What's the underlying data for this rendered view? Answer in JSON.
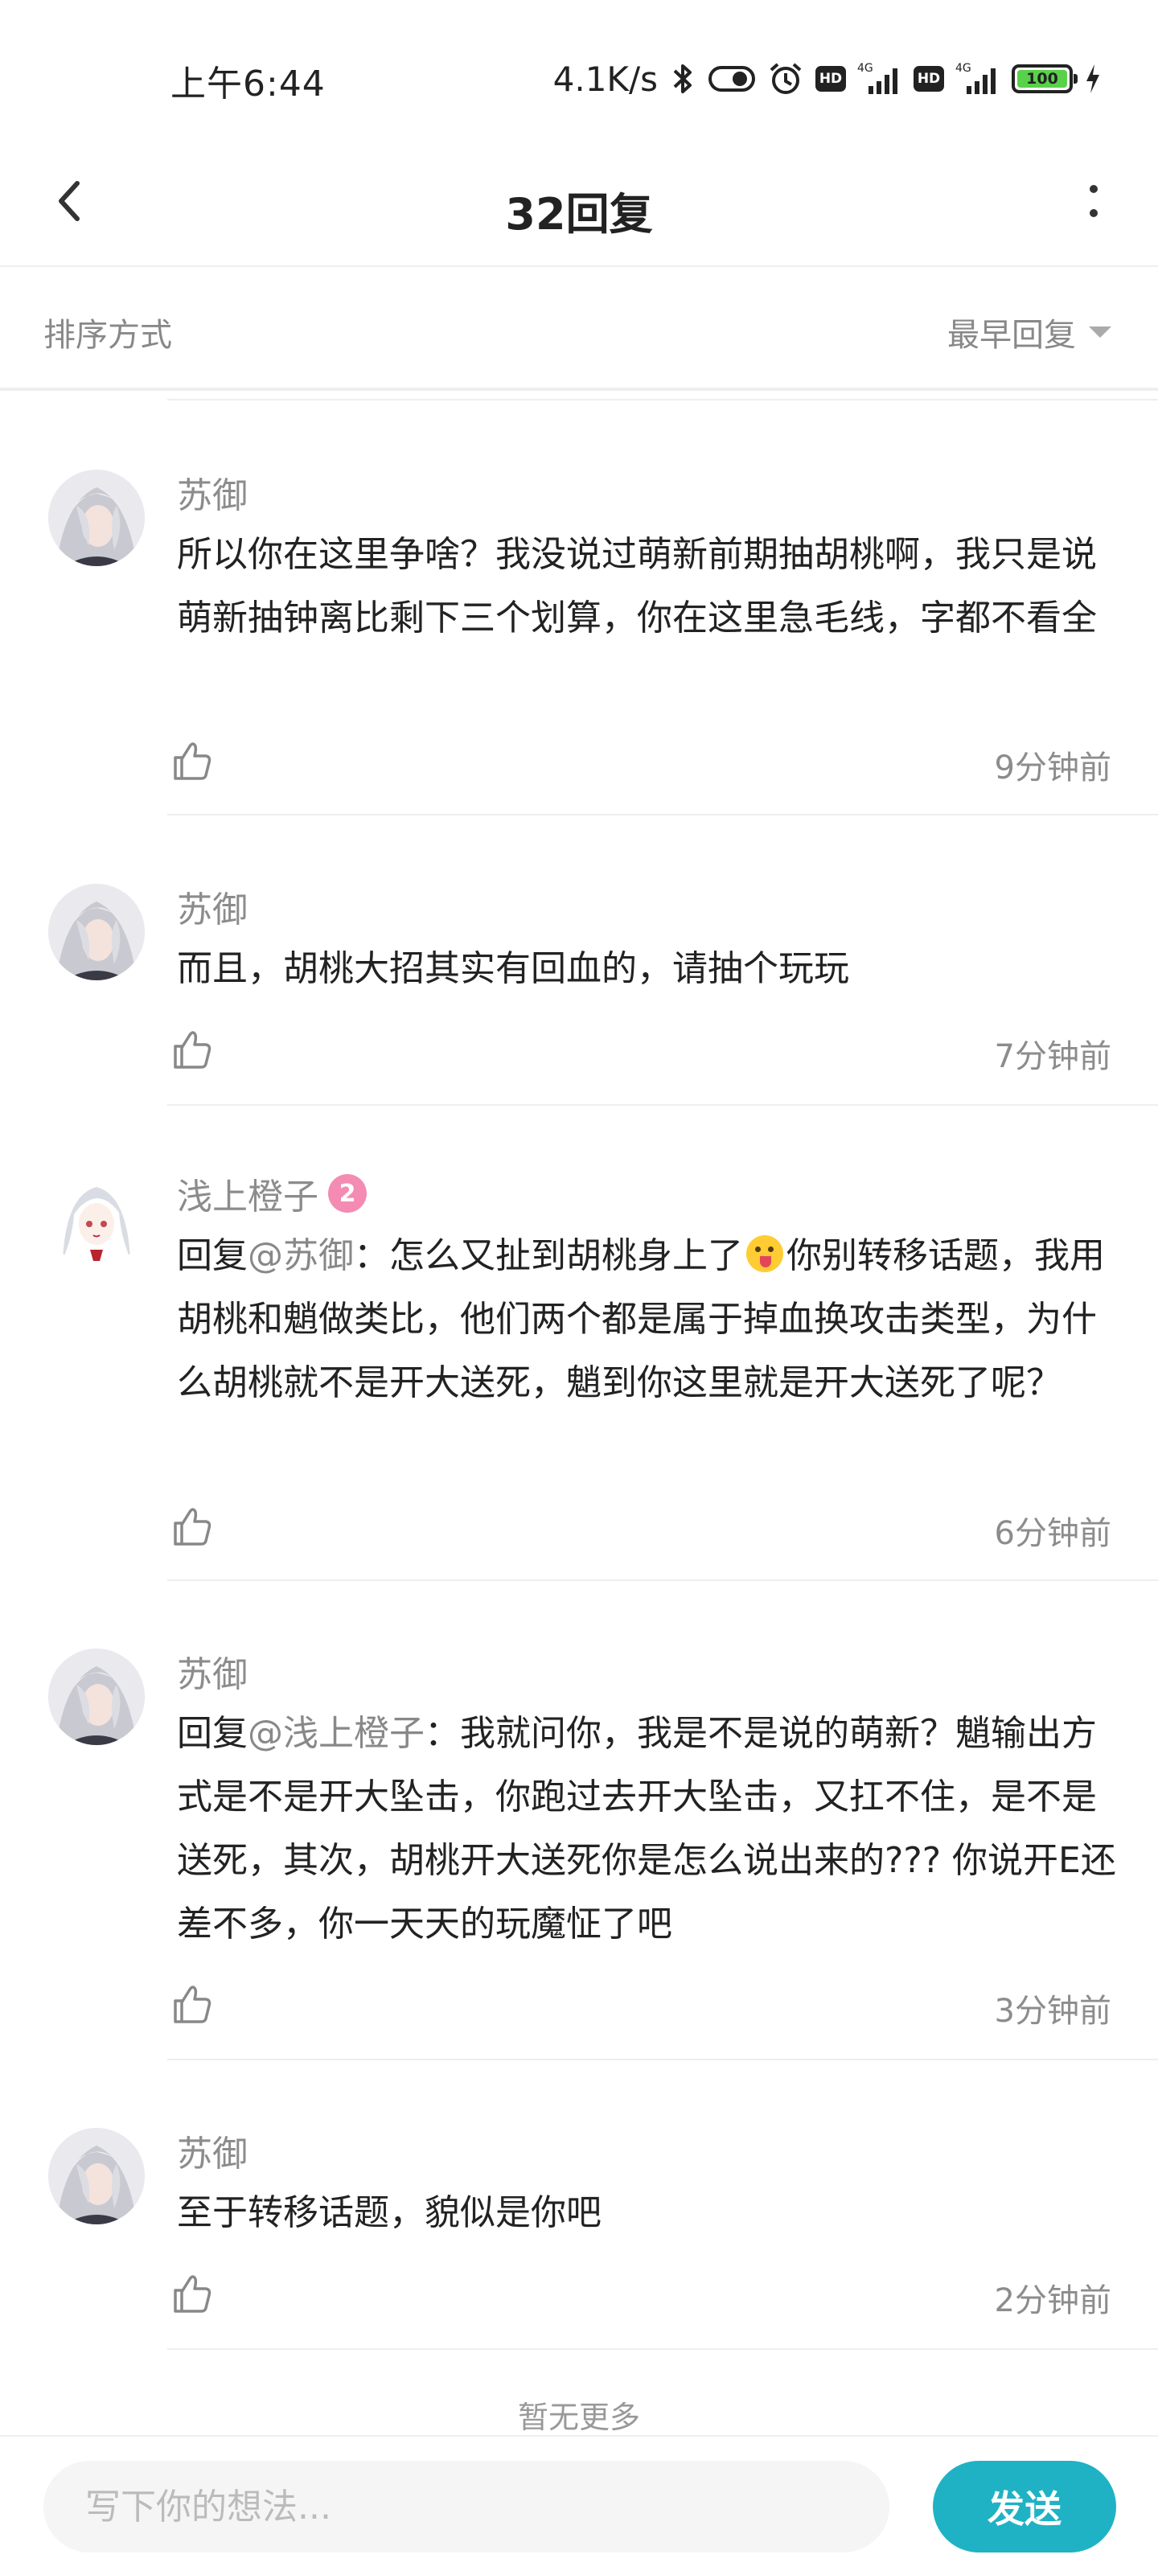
{
  "status_bar": {
    "time": "上午6:44",
    "net_speed": "4.1K/s",
    "battery": "100",
    "icons": [
      "bluetooth-icon",
      "toggle-icon",
      "alarm-icon",
      "hd-icon",
      "signal-4g-icon",
      "hd-icon",
      "signal-4g-icon",
      "battery-icon",
      "charging-icon"
    ]
  },
  "header": {
    "title": "32回复",
    "back_icon": "chevron-left-icon",
    "more_icon": "more-vertical-icon"
  },
  "sort": {
    "label": "排序方式",
    "value": "最早回复"
  },
  "comments": [
    {
      "author": "苏御",
      "reply_prefix": "",
      "mention": "",
      "text": "所以你在这里争啥？我没说过萌新前期抽胡桃啊，我只是说萌新抽钟离比剩下三个划算，你在这里急毛线，字都不看全",
      "time": "9分钟前"
    },
    {
      "author": "苏御",
      "reply_prefix": "",
      "mention": "",
      "text": "而且，胡桃大招其实有回血的，请抽个玩玩",
      "time": "7分钟前"
    },
    {
      "author": "浅上橙子",
      "level": "2",
      "reply_prefix": "回复",
      "mention": "@苏御",
      "text_a": "：怎么又扯到胡桃身上了",
      "emoji": "tongue-out-emoji",
      "text_b": "你别转移话题，我用胡桃和魈做类比，他们两个都是属于掉血换攻击类型，为什么胡桃就不是开大送死，魈到你这里就是开大送死了呢？",
      "time": "6分钟前"
    },
    {
      "author": "苏御",
      "reply_prefix": "回复",
      "mention": "@浅上橙子",
      "text": "：我就问你，我是不是说的萌新？魈输出方式是不是开大坠击，你跑过去开大坠击，又扛不住，是不是送死，其次，胡桃开大送死你是怎么说出来的??? 你说开E还差不多，你一天天的玩魔怔了吧",
      "time": "3分钟前"
    },
    {
      "author": "苏御",
      "reply_prefix": "",
      "mention": "",
      "text": "至于转移话题，貌似是你吧",
      "time": "2分钟前"
    }
  ],
  "footer_note": "暂无更多",
  "input": {
    "placeholder": "写下你的想法...",
    "send_label": "发送"
  },
  "colors": {
    "accent": "#1fb2c5",
    "secondary_text": "#8c8c8c",
    "level_badge": "#f48bb3"
  }
}
